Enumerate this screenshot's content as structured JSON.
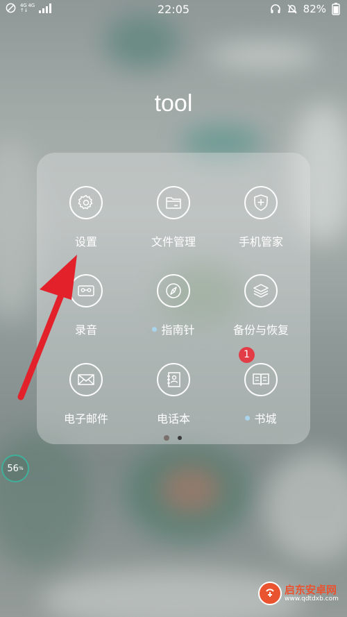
{
  "status_bar": {
    "network_top": "4G 4G",
    "network_bottom": "↑↓",
    "time": "22:05",
    "battery": "82%"
  },
  "folder": {
    "title": "tool",
    "apps": [
      {
        "label": "设置",
        "icon": "gear-icon"
      },
      {
        "label": "文件管理",
        "icon": "folder-icon"
      },
      {
        "label": "手机管家",
        "icon": "shield-plus-icon"
      },
      {
        "label": "录音",
        "icon": "cassette-icon"
      },
      {
        "label": "指南针",
        "icon": "compass-icon",
        "new": true
      },
      {
        "label": "备份与恢复",
        "icon": "layers-icon"
      },
      {
        "label": "电子邮件",
        "icon": "envelope-icon"
      },
      {
        "label": "电话本",
        "icon": "contacts-icon"
      },
      {
        "label": "书城",
        "icon": "book-icon",
        "new": true,
        "badge": "1"
      }
    ],
    "pages": 2,
    "active_page": 1
  },
  "memory_widget": {
    "value": "56",
    "unit": "%"
  },
  "watermark": {
    "name": "启东安卓网",
    "url": "www.qdtdxb.com"
  },
  "colors": {
    "badge": "#e23d47",
    "arrow": "#e3212b",
    "new_dot": "#a9d4ec",
    "memory_ring": "#3fb09a"
  }
}
